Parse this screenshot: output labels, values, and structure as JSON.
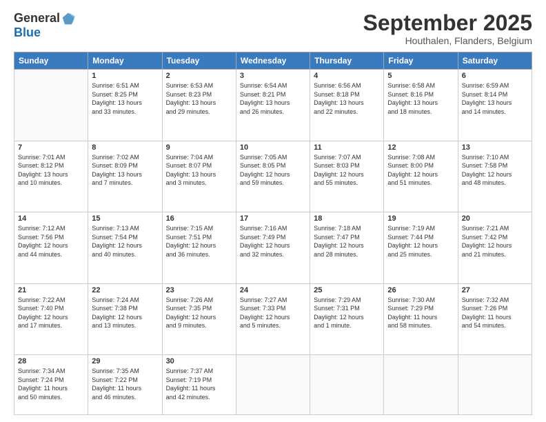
{
  "logo": {
    "general": "General",
    "blue": "Blue"
  },
  "title": "September 2025",
  "subtitle": "Houthalen, Flanders, Belgium",
  "header_days": [
    "Sunday",
    "Monday",
    "Tuesday",
    "Wednesday",
    "Thursday",
    "Friday",
    "Saturday"
  ],
  "weeks": [
    [
      {
        "day": "",
        "info": ""
      },
      {
        "day": "1",
        "info": "Sunrise: 6:51 AM\nSunset: 8:25 PM\nDaylight: 13 hours\nand 33 minutes."
      },
      {
        "day": "2",
        "info": "Sunrise: 6:53 AM\nSunset: 8:23 PM\nDaylight: 13 hours\nand 29 minutes."
      },
      {
        "day": "3",
        "info": "Sunrise: 6:54 AM\nSunset: 8:21 PM\nDaylight: 13 hours\nand 26 minutes."
      },
      {
        "day": "4",
        "info": "Sunrise: 6:56 AM\nSunset: 8:18 PM\nDaylight: 13 hours\nand 22 minutes."
      },
      {
        "day": "5",
        "info": "Sunrise: 6:58 AM\nSunset: 8:16 PM\nDaylight: 13 hours\nand 18 minutes."
      },
      {
        "day": "6",
        "info": "Sunrise: 6:59 AM\nSunset: 8:14 PM\nDaylight: 13 hours\nand 14 minutes."
      }
    ],
    [
      {
        "day": "7",
        "info": "Sunrise: 7:01 AM\nSunset: 8:12 PM\nDaylight: 13 hours\nand 10 minutes."
      },
      {
        "day": "8",
        "info": "Sunrise: 7:02 AM\nSunset: 8:09 PM\nDaylight: 13 hours\nand 7 minutes."
      },
      {
        "day": "9",
        "info": "Sunrise: 7:04 AM\nSunset: 8:07 PM\nDaylight: 13 hours\nand 3 minutes."
      },
      {
        "day": "10",
        "info": "Sunrise: 7:05 AM\nSunset: 8:05 PM\nDaylight: 12 hours\nand 59 minutes."
      },
      {
        "day": "11",
        "info": "Sunrise: 7:07 AM\nSunset: 8:03 PM\nDaylight: 12 hours\nand 55 minutes."
      },
      {
        "day": "12",
        "info": "Sunrise: 7:08 AM\nSunset: 8:00 PM\nDaylight: 12 hours\nand 51 minutes."
      },
      {
        "day": "13",
        "info": "Sunrise: 7:10 AM\nSunset: 7:58 PM\nDaylight: 12 hours\nand 48 minutes."
      }
    ],
    [
      {
        "day": "14",
        "info": "Sunrise: 7:12 AM\nSunset: 7:56 PM\nDaylight: 12 hours\nand 44 minutes."
      },
      {
        "day": "15",
        "info": "Sunrise: 7:13 AM\nSunset: 7:54 PM\nDaylight: 12 hours\nand 40 minutes."
      },
      {
        "day": "16",
        "info": "Sunrise: 7:15 AM\nSunset: 7:51 PM\nDaylight: 12 hours\nand 36 minutes."
      },
      {
        "day": "17",
        "info": "Sunrise: 7:16 AM\nSunset: 7:49 PM\nDaylight: 12 hours\nand 32 minutes."
      },
      {
        "day": "18",
        "info": "Sunrise: 7:18 AM\nSunset: 7:47 PM\nDaylight: 12 hours\nand 28 minutes."
      },
      {
        "day": "19",
        "info": "Sunrise: 7:19 AM\nSunset: 7:44 PM\nDaylight: 12 hours\nand 25 minutes."
      },
      {
        "day": "20",
        "info": "Sunrise: 7:21 AM\nSunset: 7:42 PM\nDaylight: 12 hours\nand 21 minutes."
      }
    ],
    [
      {
        "day": "21",
        "info": "Sunrise: 7:22 AM\nSunset: 7:40 PM\nDaylight: 12 hours\nand 17 minutes."
      },
      {
        "day": "22",
        "info": "Sunrise: 7:24 AM\nSunset: 7:38 PM\nDaylight: 12 hours\nand 13 minutes."
      },
      {
        "day": "23",
        "info": "Sunrise: 7:26 AM\nSunset: 7:35 PM\nDaylight: 12 hours\nand 9 minutes."
      },
      {
        "day": "24",
        "info": "Sunrise: 7:27 AM\nSunset: 7:33 PM\nDaylight: 12 hours\nand 5 minutes."
      },
      {
        "day": "25",
        "info": "Sunrise: 7:29 AM\nSunset: 7:31 PM\nDaylight: 12 hours\nand 1 minute."
      },
      {
        "day": "26",
        "info": "Sunrise: 7:30 AM\nSunset: 7:29 PM\nDaylight: 11 hours\nand 58 minutes."
      },
      {
        "day": "27",
        "info": "Sunrise: 7:32 AM\nSunset: 7:26 PM\nDaylight: 11 hours\nand 54 minutes."
      }
    ],
    [
      {
        "day": "28",
        "info": "Sunrise: 7:34 AM\nSunset: 7:24 PM\nDaylight: 11 hours\nand 50 minutes."
      },
      {
        "day": "29",
        "info": "Sunrise: 7:35 AM\nSunset: 7:22 PM\nDaylight: 11 hours\nand 46 minutes."
      },
      {
        "day": "30",
        "info": "Sunrise: 7:37 AM\nSunset: 7:19 PM\nDaylight: 11 hours\nand 42 minutes."
      },
      {
        "day": "",
        "info": ""
      },
      {
        "day": "",
        "info": ""
      },
      {
        "day": "",
        "info": ""
      },
      {
        "day": "",
        "info": ""
      }
    ]
  ]
}
